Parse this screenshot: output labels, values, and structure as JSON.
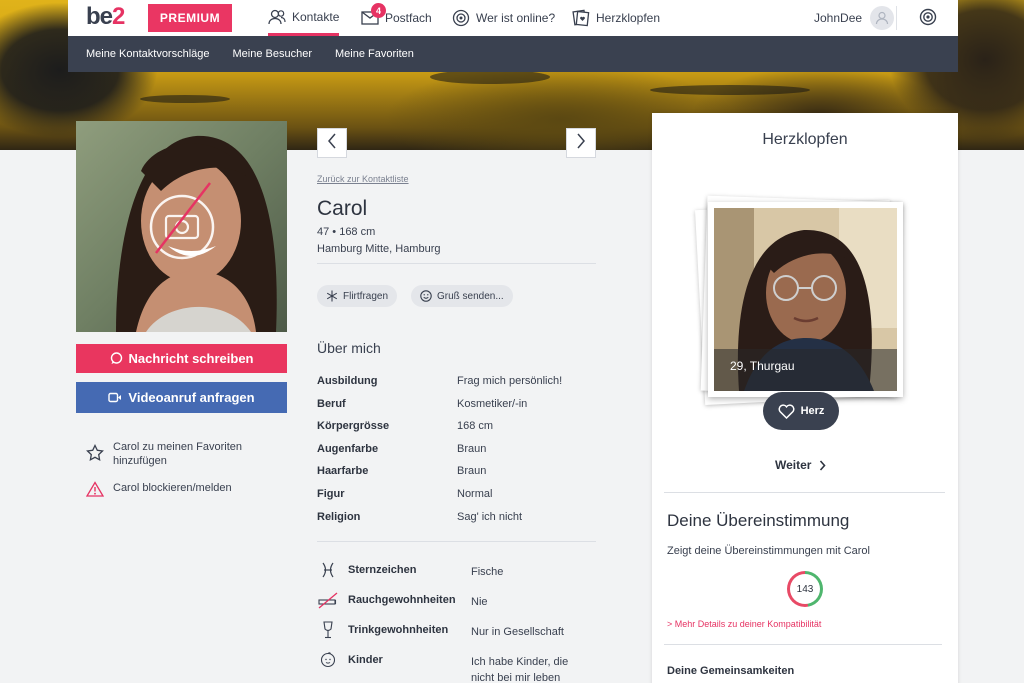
{
  "brand": {
    "logo_text_a": "be",
    "logo_text_b": "2",
    "premium_label": "PREMIUM",
    "accent": "#e63363",
    "dark": "#3a4150",
    "video_blue": "#456ab3"
  },
  "topnav": {
    "items": [
      {
        "label": "Kontakte",
        "icon": "contacts-icon",
        "active": true
      },
      {
        "label": "Postfach",
        "icon": "mail-icon",
        "badge": "4"
      },
      {
        "label": "Wer ist online?",
        "icon": "online-icon"
      },
      {
        "label": "Herzklopfen",
        "icon": "herzklopfen-icon"
      }
    ],
    "username": "JohnDee"
  },
  "subnav": {
    "items": [
      "Meine Kontaktvorschläge",
      "Meine Besucher",
      "Meine Favoriten"
    ]
  },
  "profile": {
    "back_link": "Zurück zur Kontaktliste",
    "name": "Carol",
    "age_height": "47 • 168 cm",
    "location": "Hamburg Mitte, Hamburg",
    "chips": [
      {
        "label": "Flirtfragen",
        "icon": "snowflake-icon"
      },
      {
        "label": "Gruß senden...",
        "icon": "smiley-icon"
      }
    ],
    "about_title": "Über mich",
    "attributes": [
      {
        "key": "Ausbildung",
        "value": "Frag mich persönlich!"
      },
      {
        "key": "Beruf",
        "value": "Kosmetiker/-in"
      },
      {
        "key": "Körpergrösse",
        "value": "168 cm"
      },
      {
        "key": "Augenfarbe",
        "value": "Braun"
      },
      {
        "key": "Haarfarbe",
        "value": "Braun"
      },
      {
        "key": "Figur",
        "value": "Normal"
      },
      {
        "key": "Religion",
        "value": "Sag' ich nicht"
      }
    ],
    "lifestyle": [
      {
        "key": "Sternzeichen",
        "value": "Fische",
        "icon": "pisces-icon"
      },
      {
        "key": "Rauchgewohnheiten",
        "value": "Nie",
        "icon": "no-smoking-icon"
      },
      {
        "key": "Trinkgewohnheiten",
        "value": "Nur in Gesellschaft",
        "icon": "glass-icon"
      },
      {
        "key": "Kinder",
        "value": "Ich habe Kinder, die nicht bei mir leben",
        "icon": "child-icon"
      }
    ]
  },
  "actions": {
    "message": "Nachricht schreiben",
    "video": "Videoanruf anfragen",
    "favorite": "Carol zu meinen Favoriten hinzufügen",
    "block": "Carol blockieren/melden"
  },
  "herzklopfen": {
    "title": "Herzklopfen",
    "card_caption": "29, Thurgau",
    "herz_label": "Herz",
    "weiter_label": "Weiter"
  },
  "match": {
    "title": "Deine Übereinstimmung",
    "subtitle": "Zeigt deine Übereinstimmungen mit Carol",
    "score": "143",
    "more_link": "> Mehr Details zu deiner Kompatibilität",
    "common_title": "Deine Gemeinsamkeiten"
  }
}
